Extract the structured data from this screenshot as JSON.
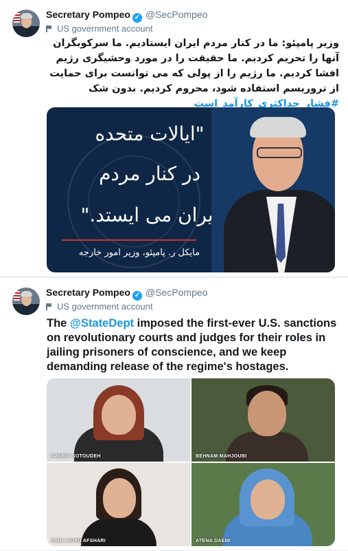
{
  "tweets": [
    {
      "author": "Secretary Pompeo",
      "handle": "@SecPompeo",
      "account_label": "US government account",
      "text": "وزیر پامپئو: ما در کنار مردم ایران ایستادیم. ما سرکوبگران آنها را تحریم کردیم. ما حقیقت را در مورد وحشیگری رژیم افشا کردیم. ما رژیم را از پولی که می توانست برای حمایت از تروریسم استفاده شود، محروم کردیم. بدون شک",
      "hashtag": "#فشار_حداکثری_کارآمد_است",
      "image": {
        "quote_line1": "\"ایالات متحده",
        "quote_line2": "در کنار مردم",
        "quote_line3": "ایران می ایستد.\"",
        "byline": "مایکل ر. پامپئو، وزیر امور خارجه"
      }
    },
    {
      "author": "Secretary Pompeo",
      "handle": "@SecPompeo",
      "account_label": "US government account",
      "text_prefix": "The ",
      "mention": "@StateDept",
      "text_suffix": " imposed the first-ever U.S. sanctions on revolutionary courts and judges for their roles in jailing prisoners of conscience, and we keep demanding release of the regime's hostages.",
      "photos": [
        {
          "caption": "NASRIN SOTOUDEH"
        },
        {
          "caption": "BEHNAM MAHJOUBI"
        },
        {
          "caption": "SABA KORD AFSHARI"
        },
        {
          "caption": "ATENA DAEMI"
        }
      ]
    }
  ],
  "icons": {
    "verified": "verified-badge-icon",
    "gov": "flag-icon"
  },
  "colors": {
    "link": "#1b95e0",
    "verified": "#1da1f2",
    "muted": "#657786"
  }
}
